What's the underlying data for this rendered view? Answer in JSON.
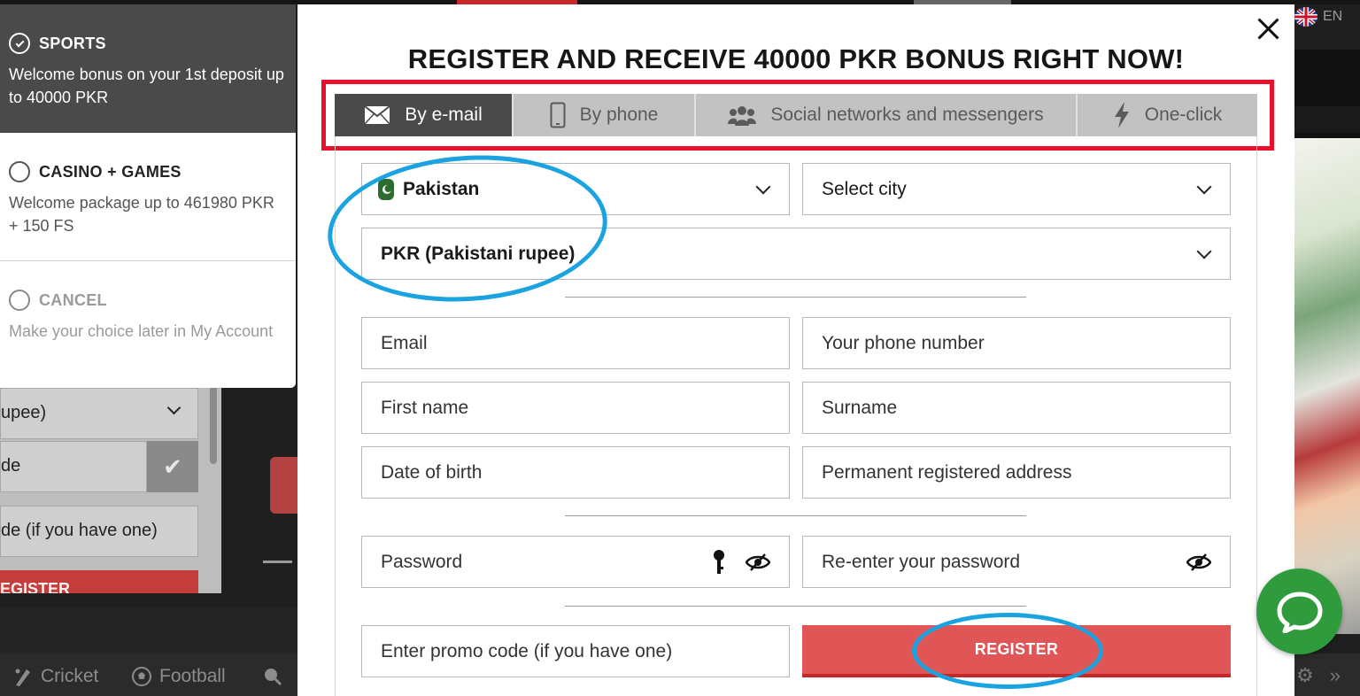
{
  "background": {
    "language": "EN",
    "left_form": {
      "currency_fragment": "upee)",
      "code_fragment": "de",
      "promo_fragment": "de (if you have one)",
      "register_fragment": "EGISTER"
    },
    "bottom_nav": [
      {
        "label": "Cricket",
        "icon": "cricket-icon"
      },
      {
        "label": "Football",
        "icon": "football-icon"
      }
    ]
  },
  "bonus": {
    "options": [
      {
        "title": "SPORTS",
        "description": "Welcome bonus on your 1st deposit up to 40000 PKR",
        "selected": true
      },
      {
        "title": "CASINO + GAMES",
        "description": "Welcome package up to 461980 PKR + 150 FS",
        "selected": false
      },
      {
        "title": "CANCEL",
        "description": "Make your choice later in My Account",
        "selected": false
      }
    ]
  },
  "modal": {
    "title": "REGISTER AND RECEIVE 40000 PKR BONUS RIGHT NOW!",
    "tabs": [
      {
        "label": "By e-mail",
        "icon": "envelope-icon",
        "active": true
      },
      {
        "label": "By phone",
        "icon": "phone-icon",
        "active": false
      },
      {
        "label": "Social networks and messengers",
        "icon": "people-icon",
        "active": false
      },
      {
        "label": "One-click",
        "icon": "lightning-icon",
        "active": false
      }
    ],
    "country": "Pakistan",
    "city_placeholder": "Select city",
    "currency": "PKR (Pakistani rupee)",
    "fields": {
      "email": "Email",
      "phone": "Your phone number",
      "first_name": "First name",
      "surname": "Surname",
      "dob": "Date of birth",
      "address": "Permanent registered address",
      "password": "Password",
      "password_repeat": "Re-enter your password",
      "promo": "Enter promo code (if you have one)"
    },
    "register_label": "REGISTER"
  },
  "colors": {
    "accent_red": "#e05555",
    "highlight_red": "#e8102a",
    "annotation_blue": "#1aa3e0",
    "active_tab": "#4a4a4a",
    "chat_green": "#2f9b3c"
  }
}
